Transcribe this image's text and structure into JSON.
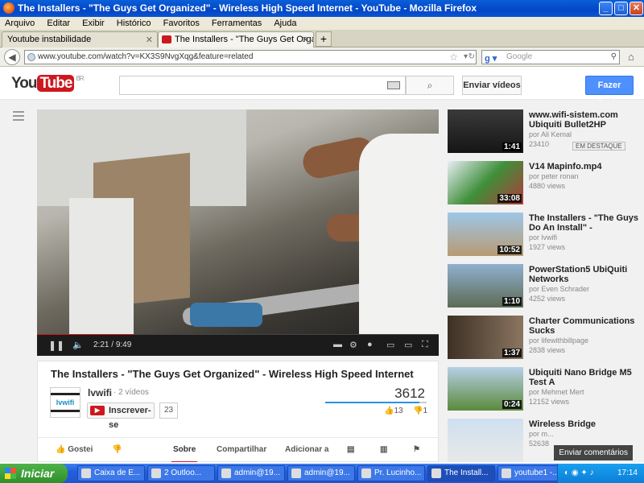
{
  "window": {
    "title": "The Installers - \"The Guys Get Organized\" - Wireless High Speed Internet - YouTube - Mozilla Firefox",
    "min": "_",
    "max": "□",
    "close": "✕"
  },
  "menu": [
    "Arquivo",
    "Editar",
    "Exibir",
    "Histórico",
    "Favoritos",
    "Ferramentas",
    "Ajuda"
  ],
  "tabs": [
    {
      "label": "Youtube instabilidade",
      "close": "✕"
    },
    {
      "label": "The Installers - \"The Guys Get Organized\" ...",
      "close": "✕"
    }
  ],
  "newtab": "+",
  "nav": {
    "url": "www.youtube.com/watch?v=KX3S9NvgXqg&feature=related",
    "search_placeholder": "Google",
    "back": "◀"
  },
  "yt": {
    "logo_you": "You",
    "logo_tube": "Tube",
    "region": "BR",
    "upload": "Enviar vídeos",
    "login": "Fazer login",
    "search_icon": "⌕"
  },
  "video": {
    "time_current": "2:21",
    "time_total": "9:49",
    "progress": 0.24,
    "title": "The Installers - \"The Guys Get Organized\" - Wireless High Speed Internet",
    "channel": "lvwifi",
    "channel_logo": "lvwifi",
    "channel_videos": "· 2 vídeos",
    "subscribe": "Inscrever-se",
    "subscribe_count": "23",
    "views": "3612",
    "likes": "13",
    "dislikes": "1",
    "like_ratio": 0.929
  },
  "actions": {
    "like": "Gostei",
    "about": "Sobre",
    "share": "Compartilhar",
    "add": "Adicionar a"
  },
  "related": [
    {
      "title": "www.wifi-sistem.com Ubiquiti Bullet2HP",
      "by": "por Ali Kemal",
      "views": "23410",
      "duration": "1:41",
      "badge": "EM DESTAQUE"
    },
    {
      "title": "V14 Mapinfo.mp4",
      "by": "por peter ronan",
      "views": "4880 views",
      "duration": "33:08"
    },
    {
      "title": "The Installers - \"The Guys Do An Install\" -",
      "by": "por lvwifi",
      "views": "1927 views",
      "duration": "10:52"
    },
    {
      "title": "PowerStation5 UbiQuiti Networks",
      "by": "por Even Schrader",
      "views": "4252 views",
      "duration": "1:10"
    },
    {
      "title": "Charter Communications Sucks",
      "by": "por lifewithbillpage",
      "views": "2838 views",
      "duration": "1:37"
    },
    {
      "title": "Ubiquiti Nano Bridge M5 Test A",
      "by": "por Mehmet Mert",
      "views": "12152 views",
      "duration": "0:24"
    },
    {
      "title": "Wireless Bridge",
      "by": "por m...",
      "views": "52638",
      "duration": ""
    }
  ],
  "feedback": "Enviar comentários",
  "taskbar": {
    "start": "Iniciar",
    "items": [
      "Caixa de E...",
      "2 Outloo...",
      "admin@19...",
      "admin@19...",
      "Pr. Lucinho...",
      "The Install...",
      "youtube1 -..."
    ],
    "lang": "PT",
    "clock": "17:14"
  }
}
